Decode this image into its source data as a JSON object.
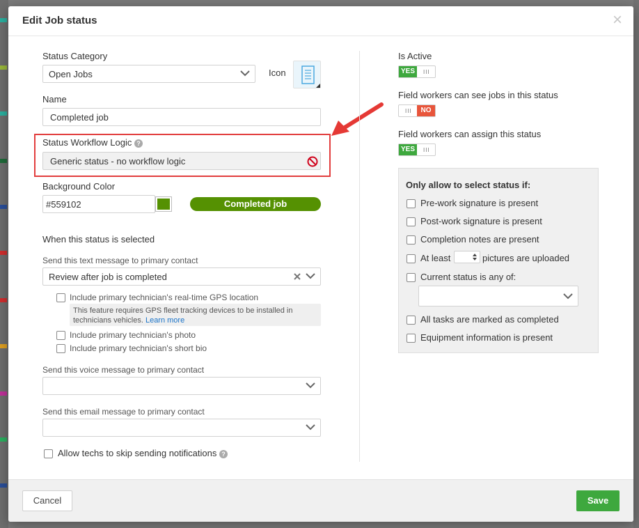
{
  "dialog": {
    "title": "Edit Job status",
    "close_symbol": "×"
  },
  "left": {
    "status_category_label": "Status Category",
    "status_category_value": "Open Jobs",
    "icon_label": "Icon",
    "name_label": "Name",
    "name_value": "Completed job",
    "workflow_label": "Status Workflow Logic",
    "workflow_value": "Generic status - no workflow logic",
    "bg_color_label": "Background Color",
    "bg_color_value": "#559102",
    "preview_label": "Completed job",
    "when_selected_heading": "When this status is selected",
    "text_msg_label": "Send this text message to primary contact",
    "text_msg_value": "Review after job is completed",
    "opt_gps": "Include primary technician's real-time GPS location",
    "gps_note": "This feature requires GPS fleet tracking devices to be installed in technicians vehicles.",
    "gps_note_link": "Learn more",
    "opt_photo": "Include primary technician's photo",
    "opt_bio": "Include primary technician's short bio",
    "voice_msg_label": "Send this voice message to primary contact",
    "email_msg_label": "Send this email message to primary contact",
    "skip_notifications_label": "Allow techs to skip sending notifications"
  },
  "right": {
    "is_active_label": "Is Active",
    "is_active_state": "YES",
    "can_see_label": "Field workers can see jobs in this status",
    "can_see_state": "NO",
    "can_assign_label": "Field workers can assign this status",
    "can_assign_state": "YES",
    "panel_title": "Only allow to select status if:",
    "conditions": [
      "Pre-work signature is present",
      "Post-work signature is present",
      "Completion notes are present",
      "At least",
      "pictures are uploaded",
      "Current status is any of:",
      "All tasks are marked as completed",
      "Equipment information is present"
    ]
  },
  "footer": {
    "cancel_label": "Cancel",
    "save_label": "Save"
  },
  "colors": {
    "toggle_yes": "#3ea83e",
    "toggle_no": "#e8553b",
    "highlight": "#e23d3d",
    "swatch": "#559102",
    "link": "#1a73c8"
  },
  "icons": {
    "chevron": "chevron-down-icon",
    "clear": "clear-x-icon",
    "status_icon": "document-list-icon",
    "not_allowed": "no-entry-icon",
    "help": "help-circle-icon",
    "annotation_arrow": "red-arrow-annotation"
  }
}
